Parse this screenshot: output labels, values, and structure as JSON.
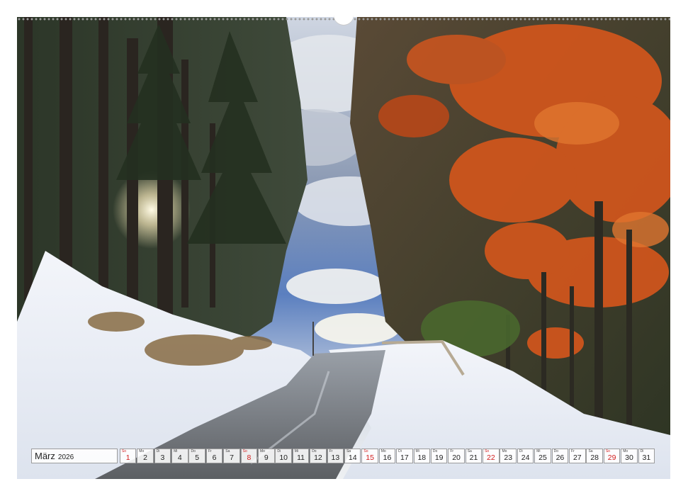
{
  "calendar": {
    "month": "März",
    "year": "2026",
    "days": [
      {
        "wd": "So",
        "d": "1",
        "sunday": true
      },
      {
        "wd": "Mo",
        "d": "2"
      },
      {
        "wd": "Di",
        "d": "3"
      },
      {
        "wd": "Mi",
        "d": "4"
      },
      {
        "wd": "Do",
        "d": "5"
      },
      {
        "wd": "Fr",
        "d": "6"
      },
      {
        "wd": "Sa",
        "d": "7"
      },
      {
        "wd": "So",
        "d": "8",
        "sunday": true
      },
      {
        "wd": "Mo",
        "d": "9"
      },
      {
        "wd": "Di",
        "d": "10"
      },
      {
        "wd": "Mi",
        "d": "11"
      },
      {
        "wd": "Do",
        "d": "12"
      },
      {
        "wd": "Fr",
        "d": "13"
      },
      {
        "wd": "Sa",
        "d": "14"
      },
      {
        "wd": "So",
        "d": "15",
        "sunday": true
      },
      {
        "wd": "Mo",
        "d": "16"
      },
      {
        "wd": "Di",
        "d": "17"
      },
      {
        "wd": "Mi",
        "d": "18"
      },
      {
        "wd": "Do",
        "d": "19"
      },
      {
        "wd": "Fr",
        "d": "20"
      },
      {
        "wd": "Sa",
        "d": "21"
      },
      {
        "wd": "So",
        "d": "22",
        "sunday": true
      },
      {
        "wd": "Mo",
        "d": "23"
      },
      {
        "wd": "Di",
        "d": "24"
      },
      {
        "wd": "Mi",
        "d": "25"
      },
      {
        "wd": "Do",
        "d": "26"
      },
      {
        "wd": "Fr",
        "d": "27"
      },
      {
        "wd": "Sa",
        "d": "28"
      },
      {
        "wd": "So",
        "d": "29",
        "sunday": true
      },
      {
        "wd": "Mo",
        "d": "30"
      },
      {
        "wd": "Di",
        "d": "31"
      }
    ]
  },
  "colors": {
    "sunday": "#d21d1d",
    "foliage": "#d2561c",
    "snow": "#eef2f8",
    "sky": "#3f6fb8"
  }
}
